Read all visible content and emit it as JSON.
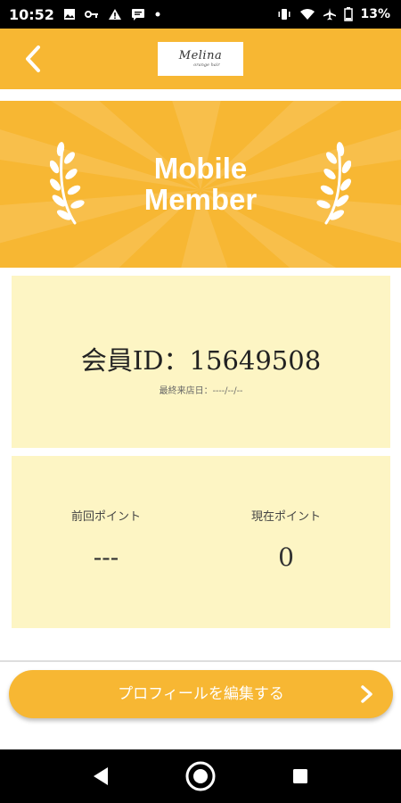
{
  "status_bar": {
    "time": "10:52",
    "battery": "13%"
  },
  "header": {
    "logo_text": "Melina",
    "logo_subtext": "orange hair"
  },
  "banner": {
    "title_line1": "Mobile",
    "title_line2": "Member"
  },
  "member": {
    "id_text": "会員ID：15649508",
    "last_visit": "最終来店日：----/--/--"
  },
  "points": {
    "previous_label": "前回ポイント",
    "previous_value": "---",
    "current_label": "現在ポイント",
    "current_value": "0"
  },
  "actions": {
    "edit_profile_label": "プロフィールを編集する"
  },
  "colors": {
    "accent": "#f7b733",
    "card_bg": "#fdf5c4",
    "text": "#222222"
  },
  "icons": {
    "back": "chevron-left-icon",
    "edit": "chevron-right-icon",
    "laurel": "laurel-icon"
  }
}
